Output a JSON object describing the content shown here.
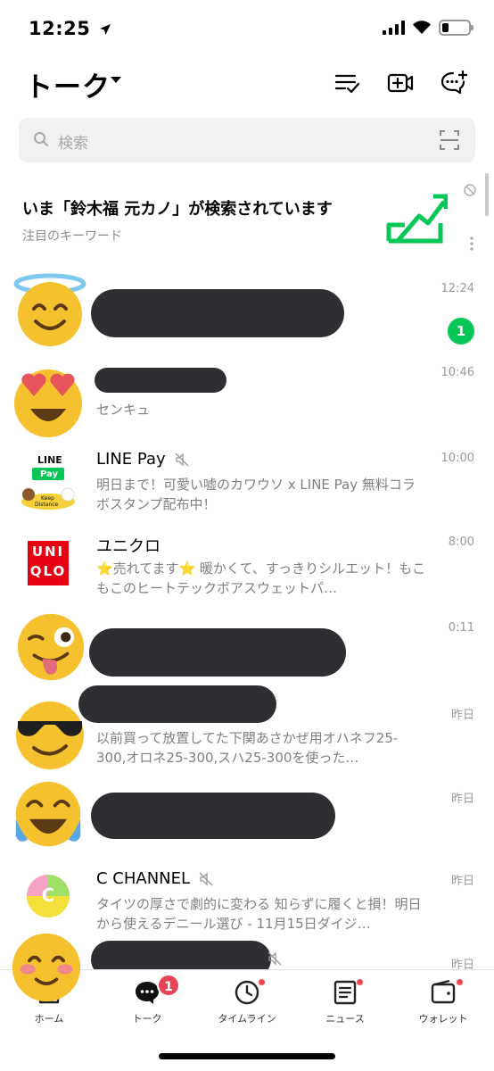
{
  "status": {
    "time": "12:25"
  },
  "header": {
    "title": "トーク"
  },
  "search": {
    "placeholder": "検索"
  },
  "trend": {
    "title": "いま「鈴木福 元カノ」が検索されています",
    "subtitle": "注目のキーワード"
  },
  "chats": [
    {
      "name": "",
      "message": "",
      "time": "12:24",
      "unread": "1"
    },
    {
      "name": "",
      "message": "センキュ",
      "time": "10:46"
    },
    {
      "name": "LINE Pay",
      "message": "明日まで！可愛い嘘のカワウソ x LINE Pay 無料コラボスタンプ配布中！",
      "time": "10:00",
      "muted": true
    },
    {
      "name": "ユニクロ",
      "message": "⭐売れてます⭐ 暖かくて、すっきりシルエット！もこもこのヒートテックボアスウェットパ…",
      "time": "8:00"
    },
    {
      "name": "",
      "message": "",
      "time": "0:11"
    },
    {
      "name": "",
      "message": "以前買って放置してた下関あさかぜ用オハネフ25-300,オロネ25-300,スハ25-300を使った…",
      "time": "昨日"
    },
    {
      "name": "",
      "message": "",
      "time": "昨日"
    },
    {
      "name": "C CHANNEL",
      "message": "タイツの厚さで劇的に変わる 知らずに履くと損！明日から使えるデニール選び - 11月15日ダイジ…",
      "time": "昨日",
      "muted": true
    },
    {
      "name": "",
      "message": "",
      "time": "昨日",
      "muted": true
    }
  ],
  "logos": {
    "linepay_line": "LINE",
    "linepay_pay": "Pay",
    "linepay_keep": "Keep",
    "linepay_distance": "Distance",
    "uniqlo_top": "UNI",
    "uniqlo_bottom": "QLO",
    "cchannel": "C"
  },
  "tabs": [
    {
      "label": "ホーム"
    },
    {
      "label": "トーク",
      "badge": "1"
    },
    {
      "label": "タイムライン"
    },
    {
      "label": "ニュース"
    },
    {
      "label": "ウォレット"
    }
  ],
  "colors": {
    "line_green": "#06c755",
    "badge_red": "#e84456",
    "redaction": "#2d2f33"
  }
}
